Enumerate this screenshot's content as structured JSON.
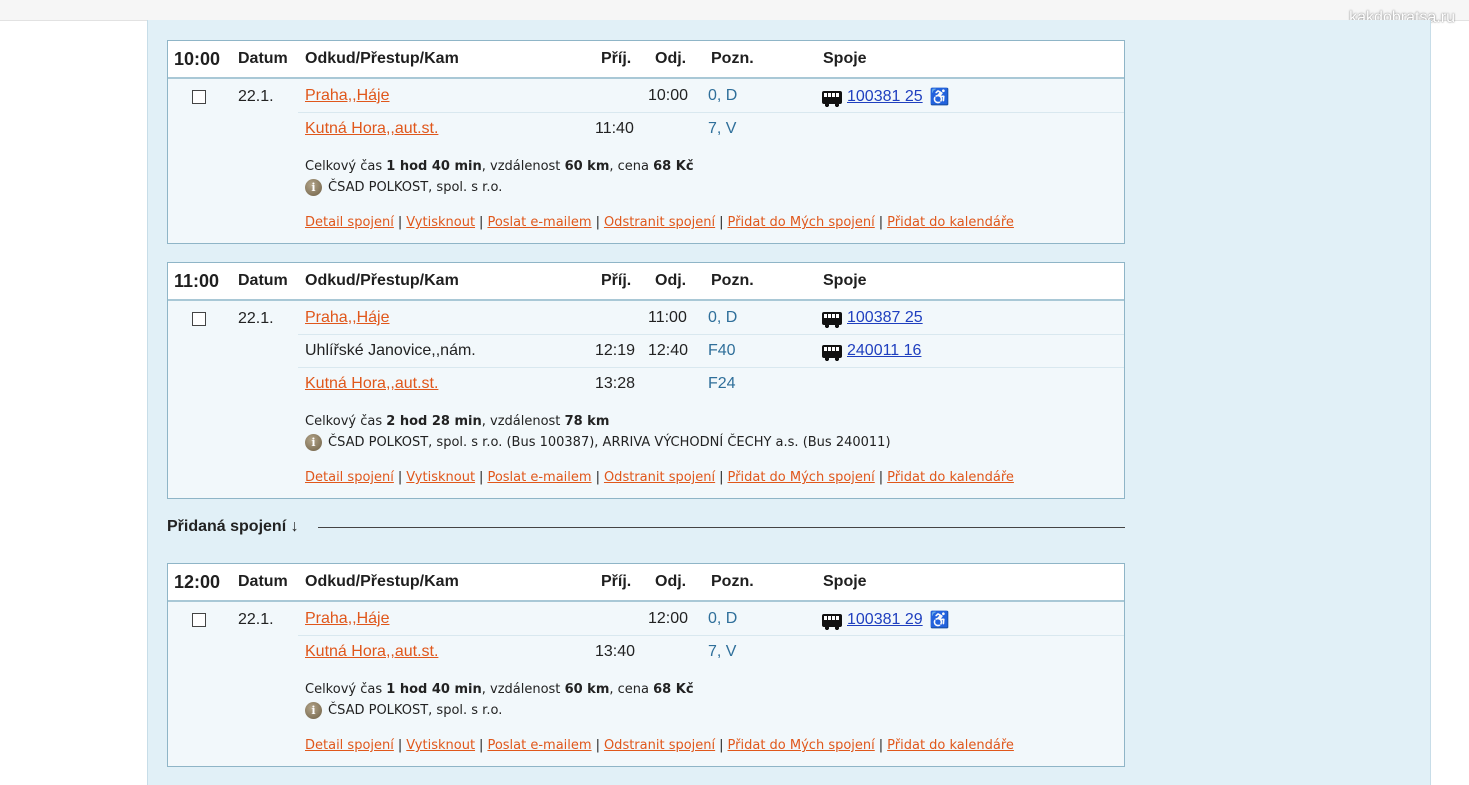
{
  "watermark": "kakdobratsa.ru",
  "headers": {
    "datum": "Datum",
    "odkud": "Odkud/Přestup/Kam",
    "prij": "Příj.",
    "odj": "Odj.",
    "pozn": "Pozn.",
    "spoje": "Spoje"
  },
  "actions": {
    "detail": "Detail spojení",
    "print": "Vytisknout",
    "email": "Poslat e-mailem",
    "remove": "Odstranit spojení",
    "add_mine": "Přidat do Mých spojení",
    "add_calendar": "Přidat do kalendáře",
    "separator": "|"
  },
  "added_label": "Přidaná spojení ↓",
  "connections": [
    {
      "time": "10:00",
      "date": "22.1.",
      "rows": [
        {
          "stop": "Praha,,Háje",
          "arr": "",
          "dep": "10:00",
          "pozn": "0, D",
          "spoj": "100381 25",
          "wheelchair": true
        },
        {
          "stop": "Kutná Hora,,aut.st.",
          "arr": "11:40",
          "dep": "",
          "pozn": "7, V",
          "spoj": "",
          "wheelchair": false
        }
      ],
      "summary": {
        "label_time": "Celkový čas",
        "total_time": "1 hod 40 min",
        "label_dist": ", vzdálenost",
        "distance": "60 km",
        "label_price": ", cena",
        "price": "68 Kč"
      },
      "operator": "ČSAD POLKOST, spol. s r.o."
    },
    {
      "time": "11:00",
      "date": "22.1.",
      "rows": [
        {
          "stop": "Praha,,Háje",
          "arr": "",
          "dep": "11:00",
          "pozn": "0, D",
          "spoj": "100387 25",
          "wheelchair": false
        },
        {
          "stop": "Uhlířské Janovice,,nám.",
          "arr": "12:19",
          "dep": "12:40",
          "pozn": "F40",
          "spoj": "240011 16",
          "wheelchair": false
        },
        {
          "stop": "Kutná Hora,,aut.st.",
          "arr": "13:28",
          "dep": "",
          "pozn": "F24",
          "spoj": "",
          "wheelchair": false
        }
      ],
      "summary": {
        "label_time": "Celkový čas",
        "total_time": "2 hod 28 min",
        "label_dist": ", vzdálenost",
        "distance": "78 km",
        "label_price": "",
        "price": ""
      },
      "operator": "ČSAD POLKOST, spol. s r.o. (Bus 100387), ARRIVA VÝCHODNÍ ČECHY a.s. (Bus 240011)"
    },
    {
      "time": "12:00",
      "date": "22.1.",
      "rows": [
        {
          "stop": "Praha,,Háje",
          "arr": "",
          "dep": "12:00",
          "pozn": "0, D",
          "spoj": "100381 29",
          "wheelchair": true
        },
        {
          "stop": "Kutná Hora,,aut.st.",
          "arr": "13:40",
          "dep": "",
          "pozn": "7, V",
          "spoj": "",
          "wheelchair": false
        }
      ],
      "summary": {
        "label_time": "Celkový čas",
        "total_time": "1 hod 40 min",
        "label_dist": ", vzdálenost",
        "distance": "60 km",
        "label_price": ", cena",
        "price": "68 Kč"
      },
      "operator": "ČSAD POLKOST, spol. s r.o."
    }
  ]
}
